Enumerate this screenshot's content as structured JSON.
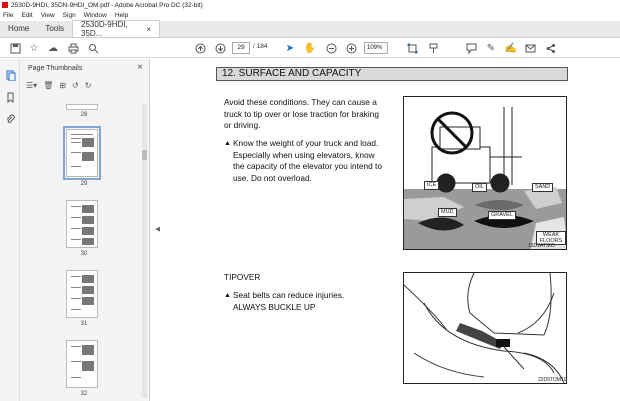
{
  "window": {
    "title": "2530D-9HDI, 35DN-9HDI_OM.pdf - Adobe Acrobat Pro DC (32-bit)"
  },
  "menu": [
    "File",
    "Edit",
    "View",
    "Sign",
    "Window",
    "Help"
  ],
  "tabs": {
    "home": "Home",
    "tools": "Tools",
    "document": "2530D-9HDI, 35D...",
    "close": "×"
  },
  "toolbar": {
    "page_current": "29",
    "page_total": "/ 184",
    "zoom": "109%"
  },
  "panel": {
    "title": "Page Thumbnails"
  },
  "thumbnails": [
    {
      "label": "28"
    },
    {
      "label": "29"
    },
    {
      "label": "30"
    },
    {
      "label": "31"
    },
    {
      "label": "32"
    }
  ],
  "document": {
    "section_title": "12. SURFACE AND CAPACITY",
    "para1": "Avoid these conditions. They can cause a truck to tip over or lose traction for braking or driving.",
    "warn1": "Know the weight of your truck and load. Especially when using elevators, know the capacity of the elevator you intend to use. Do not overload.",
    "tipover_heading": "TIPOVER",
    "warn2_line1": "Seat belts can reduce injuries.",
    "warn2_line2": "ALWAYS BUCKLE UP",
    "figure1_labels": {
      "ice": "ICE",
      "oil": "OIL",
      "sand": "SAND",
      "mud": "MUD",
      "gravel": "GRAVEL",
      "weak_floors": "WEAK FLOORS",
      "code": "15D9ATS65"
    },
    "figure2_code": "22D9TOM10"
  }
}
